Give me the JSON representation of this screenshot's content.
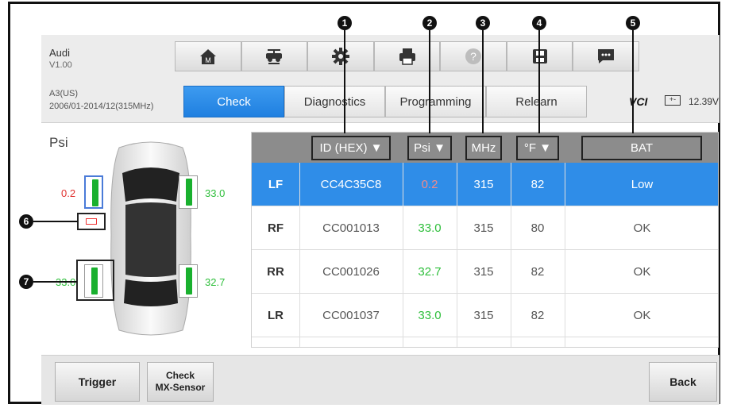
{
  "vehicle": {
    "make": "Audi",
    "version": "V1.00",
    "model": "A3(US)",
    "range": "2006/01-2014/12(315MHz)"
  },
  "toolbar": {
    "items": [
      "home-icon",
      "vehicle-lift-icon",
      "gear-icon",
      "printer-icon",
      "help-icon",
      "save-icon",
      "message-icon"
    ]
  },
  "tabs": [
    "Check",
    "Diagnostics",
    "Programming",
    "Relearn"
  ],
  "status": {
    "vci_label": "VCI",
    "voltage": "12.39V"
  },
  "left_panel": {
    "title": "Psi",
    "tire_values": {
      "lf": "0.2",
      "rf": "33.0",
      "lr": "33.0",
      "rr": "32.7"
    }
  },
  "table": {
    "headers": [
      "ID (HEX)",
      "Psi",
      "MHz",
      "°F",
      "BAT"
    ],
    "rows": [
      {
        "pos": "LF",
        "id": "CC4C35C8",
        "psi": "0.2",
        "mhz": "315",
        "temp": "82",
        "bat": "Low"
      },
      {
        "pos": "RF",
        "id": "CC001013",
        "psi": "33.0",
        "mhz": "315",
        "temp": "80",
        "bat": "OK"
      },
      {
        "pos": "RR",
        "id": "CC001026",
        "psi": "32.7",
        "mhz": "315",
        "temp": "82",
        "bat": "OK"
      },
      {
        "pos": "LR",
        "id": "CC001037",
        "psi": "33.0",
        "mhz": "315",
        "temp": "82",
        "bat": "OK"
      }
    ]
  },
  "callouts": [
    "1",
    "2",
    "3",
    "4",
    "5",
    "6",
    "7"
  ],
  "bottom": {
    "trigger": "Trigger",
    "check_line1": "Check",
    "check_line2": "MX-Sensor",
    "back": "Back"
  },
  "colors": {
    "accent": "#2f8de8",
    "ok_green": "#2fbf3c",
    "warn_red": "#e0302e"
  }
}
